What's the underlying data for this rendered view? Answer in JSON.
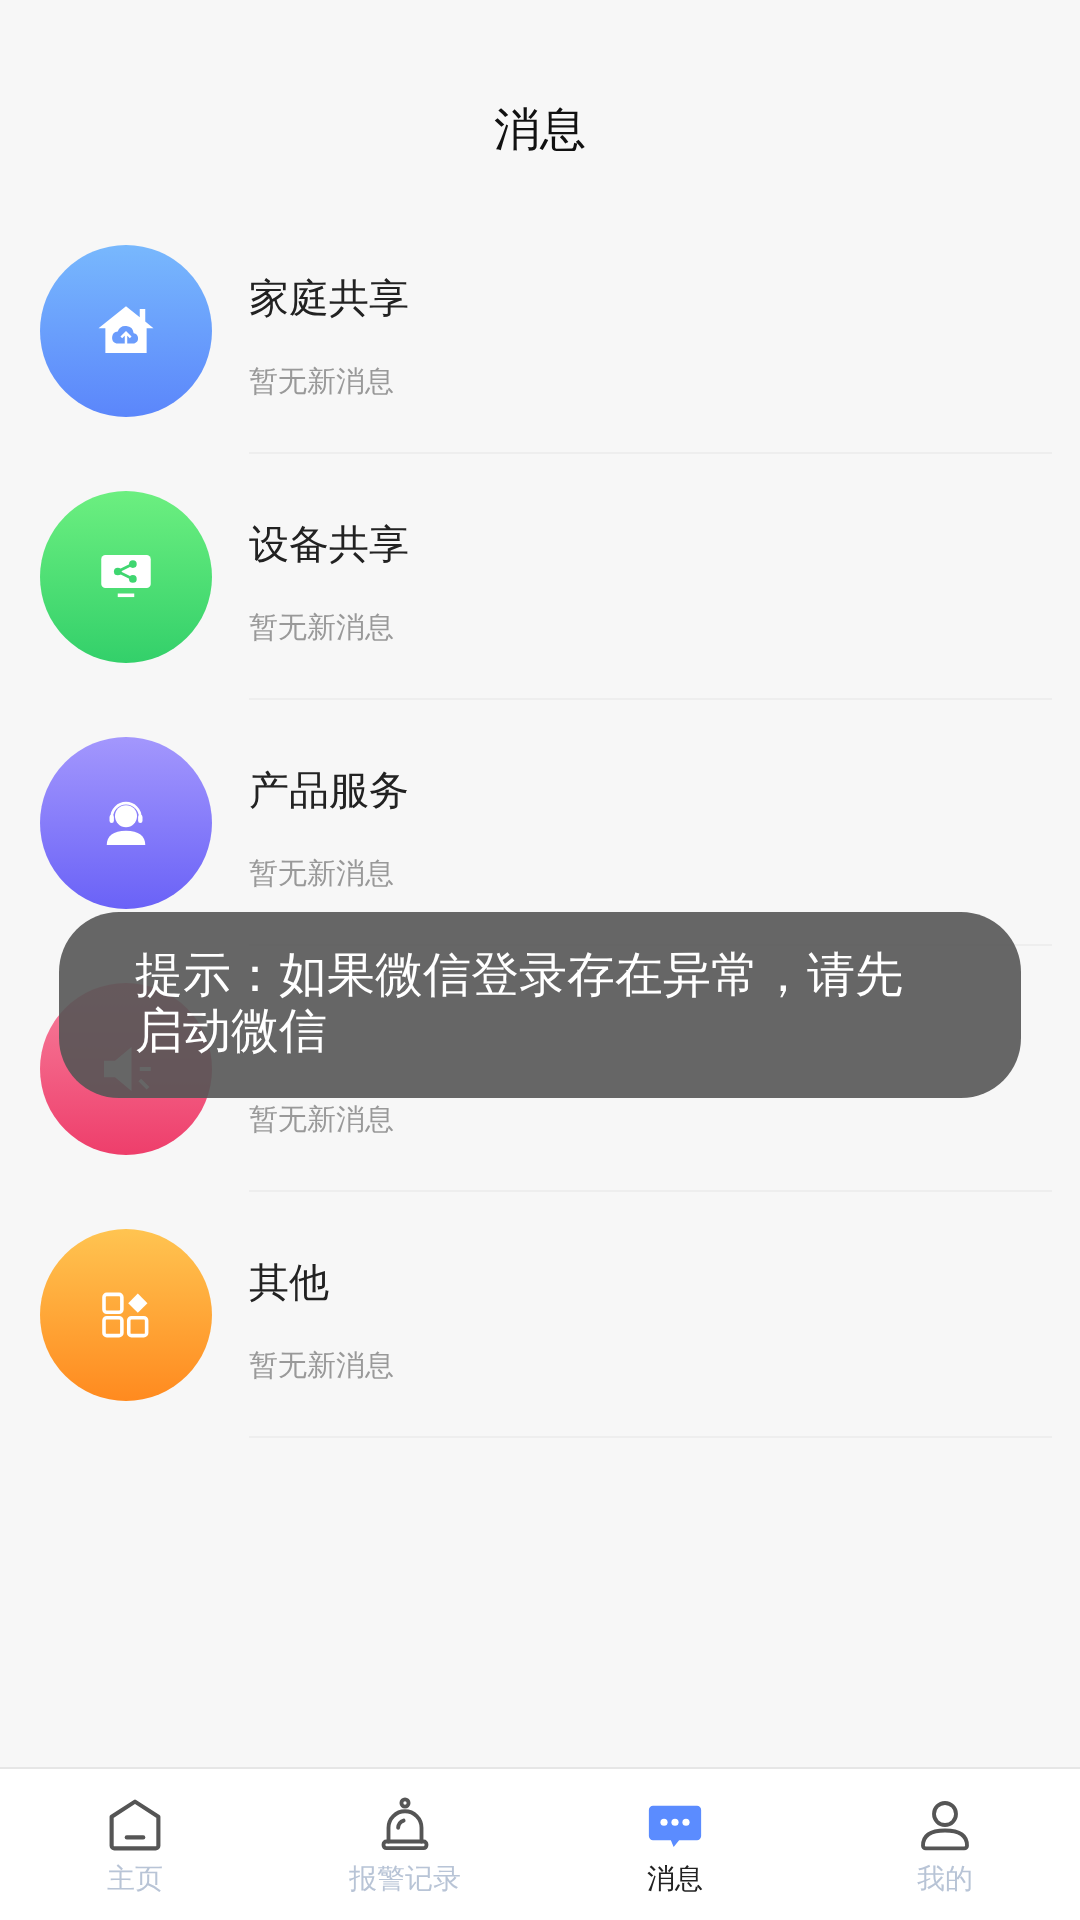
{
  "header": {
    "title": "消息"
  },
  "items": [
    {
      "kind": "home",
      "title": "家庭共享",
      "subtitle": "暂无新消息"
    },
    {
      "kind": "share",
      "title": "设备共享",
      "subtitle": "暂无新消息"
    },
    {
      "kind": "service",
      "title": "产品服务",
      "subtitle": "暂无新消息"
    },
    {
      "kind": "notice",
      "subtitle": "暂无新消息"
    },
    {
      "kind": "other",
      "title": "其他",
      "subtitle": "暂无新消息"
    }
  ],
  "toast": {
    "text": "提示：如果微信登录存在异常，请先启动微信"
  },
  "tabs": [
    {
      "kind": "home",
      "label": "主页",
      "selected": false
    },
    {
      "kind": "alarm",
      "label": "报警记录",
      "selected": false
    },
    {
      "kind": "message",
      "label": "消息",
      "selected": true
    },
    {
      "kind": "profile",
      "label": "我的",
      "selected": false
    }
  ]
}
